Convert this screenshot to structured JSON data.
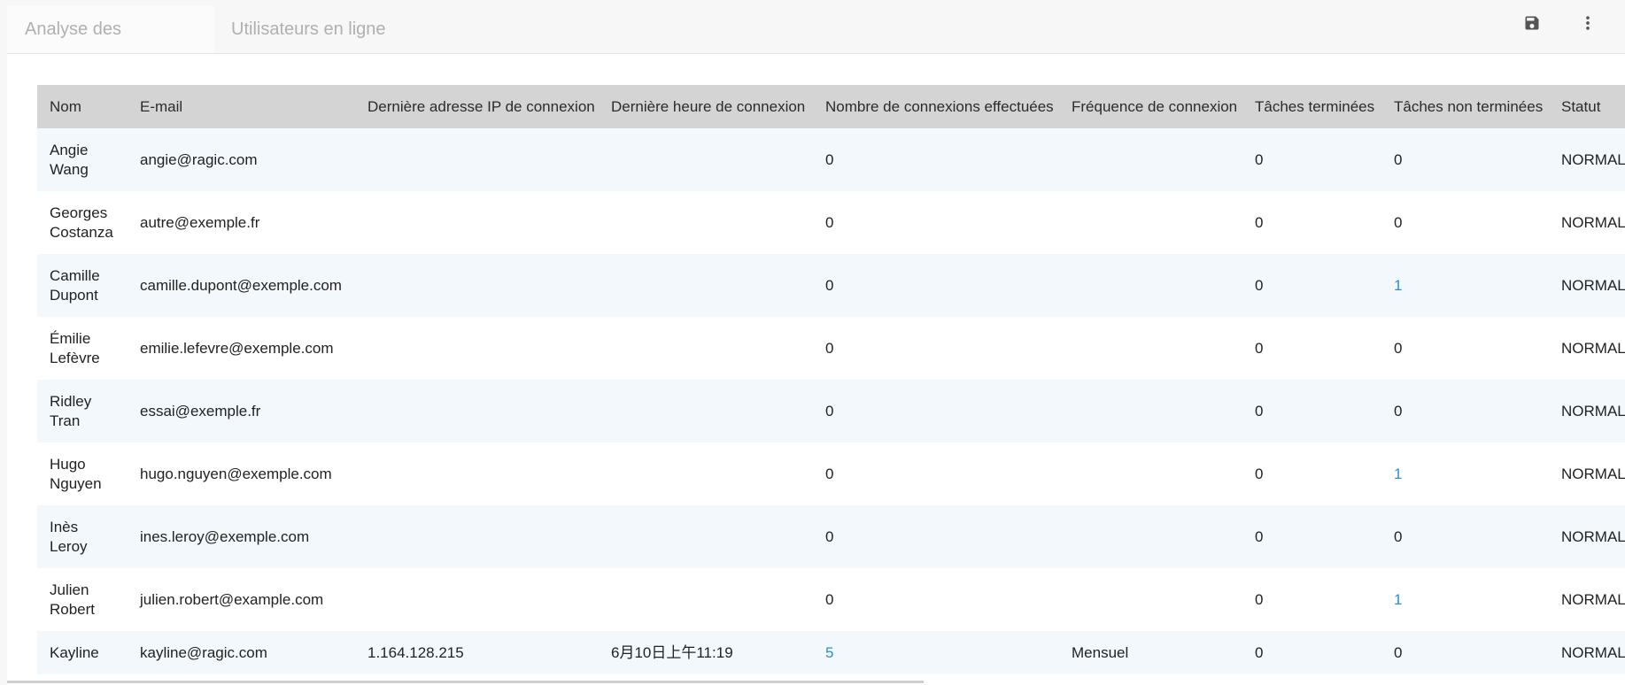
{
  "tabs": [
    {
      "label": "Analyse des utilisateurs",
      "active": true
    },
    {
      "label": "Utilisateurs en ligne",
      "active": false
    }
  ],
  "toolbar": {
    "save_icon": "save-icon",
    "more_icon": "more-vertical-icon"
  },
  "colors": {
    "header_bg": "#d4d4d4",
    "row_alt": "#f3f8fc",
    "link": "#2b8fd6"
  },
  "table": {
    "columns": [
      "Nom",
      "E-mail",
      "Dernière adresse IP de connexion",
      "Dernière heure de connexion",
      "Nombre de connexions effectuées",
      "Fréquence de connexion",
      "Tâches terminées",
      "Tâches non terminées",
      "Statut"
    ],
    "rows": [
      {
        "name": "Angie Wang",
        "email": "angie@ragic.com",
        "ip": "",
        "time": "",
        "logins": "0",
        "freq": "",
        "done": "0",
        "todo": "0",
        "status": "NORMAL"
      },
      {
        "name": "Georges Costanza",
        "email": "autre@exemple.fr",
        "ip": "",
        "time": "",
        "logins": "0",
        "freq": "",
        "done": "0",
        "todo": "0",
        "status": "NORMAL"
      },
      {
        "name": "Camille Dupont",
        "email": "camille.dupont@exemple.com",
        "ip": "",
        "time": "",
        "logins": "0",
        "freq": "",
        "done": "0",
        "todo": "1",
        "status": "NORMAL"
      },
      {
        "name": "Émilie Lefèvre",
        "email": "emilie.lefevre@exemple.com",
        "ip": "",
        "time": "",
        "logins": "0",
        "freq": "",
        "done": "0",
        "todo": "0",
        "status": "NORMAL"
      },
      {
        "name": "Ridley Tran",
        "email": "essai@exemple.fr",
        "ip": "",
        "time": "",
        "logins": "0",
        "freq": "",
        "done": "0",
        "todo": "0",
        "status": "NORMAL"
      },
      {
        "name": "Hugo Nguyen",
        "email": "hugo.nguyen@exemple.com",
        "ip": "",
        "time": "",
        "logins": "0",
        "freq": "",
        "done": "0",
        "todo": "1",
        "status": "NORMAL"
      },
      {
        "name": "Inès Leroy",
        "email": "ines.leroy@exemple.com",
        "ip": "",
        "time": "",
        "logins": "0",
        "freq": "",
        "done": "0",
        "todo": "0",
        "status": "NORMAL"
      },
      {
        "name": "Julien Robert",
        "email": "julien.robert@example.com",
        "ip": "",
        "time": "",
        "logins": "0",
        "freq": "",
        "done": "0",
        "todo": "1",
        "status": "NORMAL"
      },
      {
        "name": "Kayline",
        "email": "kayline@ragic.com",
        "ip": "1.164.128.215",
        "time": "6月10日上午11:19",
        "logins": "5",
        "freq": "Mensuel",
        "done": "0",
        "todo": "0",
        "status": "NORMAL"
      }
    ]
  }
}
